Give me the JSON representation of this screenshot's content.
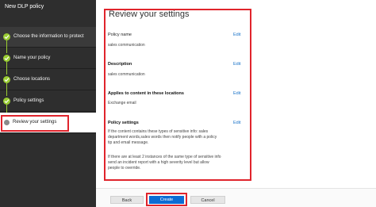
{
  "sidebar": {
    "title": "New DLP policy",
    "steps": [
      {
        "label": "Choose the information to protect",
        "status": "complete"
      },
      {
        "label": "Name your policy",
        "status": "complete"
      },
      {
        "label": "Choose locations",
        "status": "complete"
      },
      {
        "label": "Policy settings",
        "status": "complete"
      },
      {
        "label": "Review your settings",
        "status": "current"
      }
    ]
  },
  "main": {
    "title": "Review your settings",
    "policy_name": {
      "label": "Policy name",
      "value": "sales communication",
      "edit": "Edit"
    },
    "description": {
      "label": "Description",
      "value": "sales communication",
      "edit": "Edit"
    },
    "locations": {
      "label": "Applies to content in these locations",
      "value": "Exchange email",
      "edit": "Edit"
    },
    "policy_settings": {
      "label": "Policy settings",
      "edit": "Edit",
      "para1_lines": [
        "If the content contains these types of sensitive info: sales",
        "department words,sales words then notify people with a policy",
        "tip and email message."
      ],
      "para2_lines": [
        "If there are at least 2 instances of the same type of sensitive info",
        "send an incident report with a high severity level but allow",
        "people to override."
      ]
    }
  },
  "footer": {
    "back_label": "Back",
    "create_label": "Create",
    "cancel_label": "Cancel"
  },
  "colors": {
    "sidebar_bg": "#2e2e2e",
    "check_green": "#9acd32",
    "highlight_red": "#e0242c",
    "primary_blue": "#0b6cd4",
    "link_blue": "#1a73c9"
  }
}
